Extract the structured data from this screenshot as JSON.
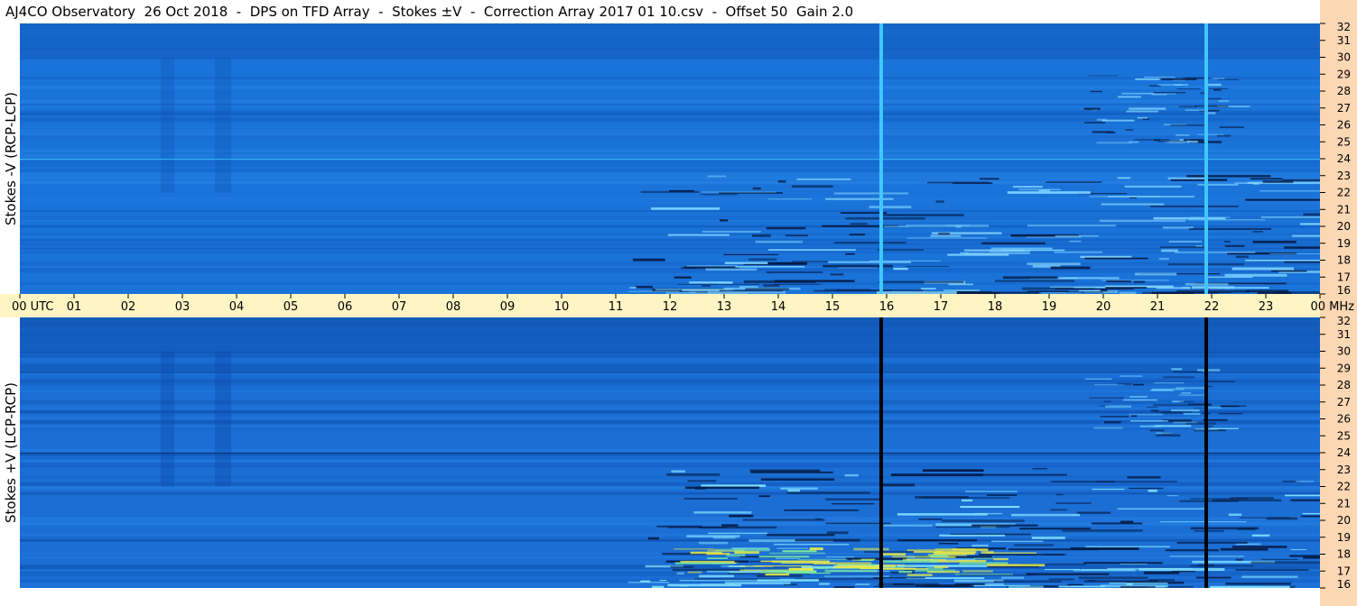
{
  "title": "AJ4CO Observatory  26 Oct 2018  -  DPS on TFD Array  -  Stokes ±V  -  Correction Array 2017 01 10.csv  -  Offset 50  Gain 2.0",
  "time_axis": {
    "labels": [
      "00 UTC",
      "01",
      "02",
      "03",
      "04",
      "05",
      "06",
      "07",
      "08",
      "09",
      "10",
      "11",
      "12",
      "13",
      "14",
      "15",
      "16",
      "17",
      "18",
      "19",
      "20",
      "21",
      "22",
      "23",
      "00 MHz"
    ]
  },
  "chart_data": [
    {
      "type": "heatmap",
      "ylabel": "Stokes -V  (RCP-LCP)",
      "x_range_utc_hours": [
        0,
        24
      ],
      "y_range_mhz": [
        16,
        32
      ],
      "y_ticks": [
        16,
        17,
        18,
        19,
        20,
        21,
        22,
        23,
        24,
        25,
        26,
        27,
        28,
        29,
        30,
        31,
        32
      ],
      "colors": {
        "background": "#1a73d8",
        "quiet_band": "#0f55b8",
        "absorption": "#041a44",
        "emission": "#7fd3ff",
        "strong_emission": "#e8e84a"
      },
      "vertical_lines": [
        {
          "utc_hour": 15.9,
          "color": "#3ec8ff"
        },
        {
          "utc_hour": 21.9,
          "color": "#3ec8ff"
        }
      ],
      "activity_start_utc_hour": 11.2
    },
    {
      "type": "heatmap",
      "ylabel": "Stokes +V  (LCP-RCP)",
      "x_range_utc_hours": [
        0,
        24
      ],
      "y_range_mhz": [
        16,
        32
      ],
      "y_ticks": [
        16,
        17,
        18,
        19,
        20,
        21,
        22,
        23,
        24,
        25,
        26,
        27,
        28,
        29,
        30,
        31,
        32
      ],
      "colors": {
        "background": "#1a6ed4",
        "quiet_band": "#0b49a6",
        "absorption": "#041a44",
        "emission": "#7fe0ff",
        "strong_emission": "#e8e84a"
      },
      "vertical_lines": [
        {
          "utc_hour": 15.9,
          "color": "#000000"
        },
        {
          "utc_hour": 21.9,
          "color": "#000000"
        }
      ],
      "activity_start_utc_hour": 11.2
    }
  ]
}
